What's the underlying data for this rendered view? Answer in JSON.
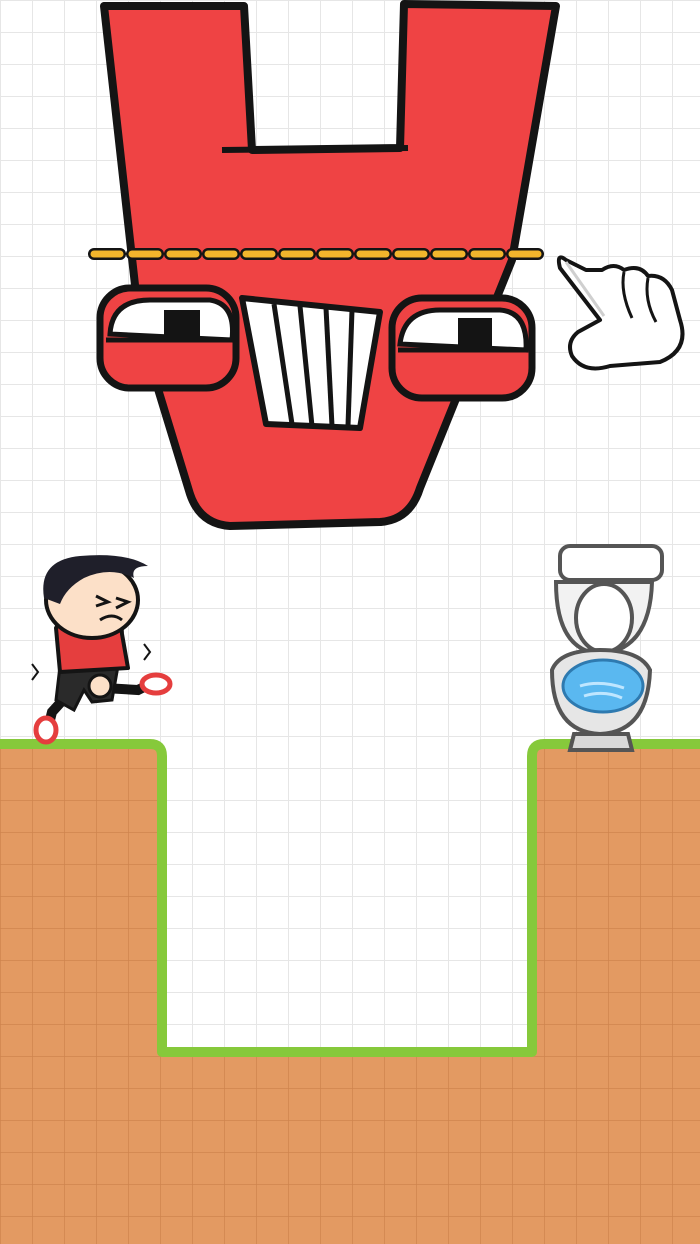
{
  "game": {
    "title": "",
    "level": null
  },
  "colors": {
    "background": "#ffffff",
    "grid_line": "#e6e6e6",
    "ground_fill": "#e39a62",
    "ground_tile": "#d3854d",
    "grass": "#86c93b",
    "monster_red": "#ef4344",
    "monster_shadow": "#c92d30",
    "outline": "#141414",
    "cut_line": "#f2b52c",
    "boy_shirt": "#e53e3e",
    "toilet_water": "#5ab8f0"
  },
  "elements": {
    "monster": {
      "name": "red-letter-monster",
      "letter": "Y",
      "orientation": "upside-down"
    },
    "cut_line": {
      "style": "dashed",
      "color": "#f2b52c"
    },
    "hand_hint": {
      "icon": "pointing-hand-icon"
    },
    "boy": {
      "state": "needs-toilet"
    },
    "toilet": {
      "icon": "toilet-icon"
    },
    "terrain": {
      "shape": "pit-between-two-ledges"
    }
  }
}
